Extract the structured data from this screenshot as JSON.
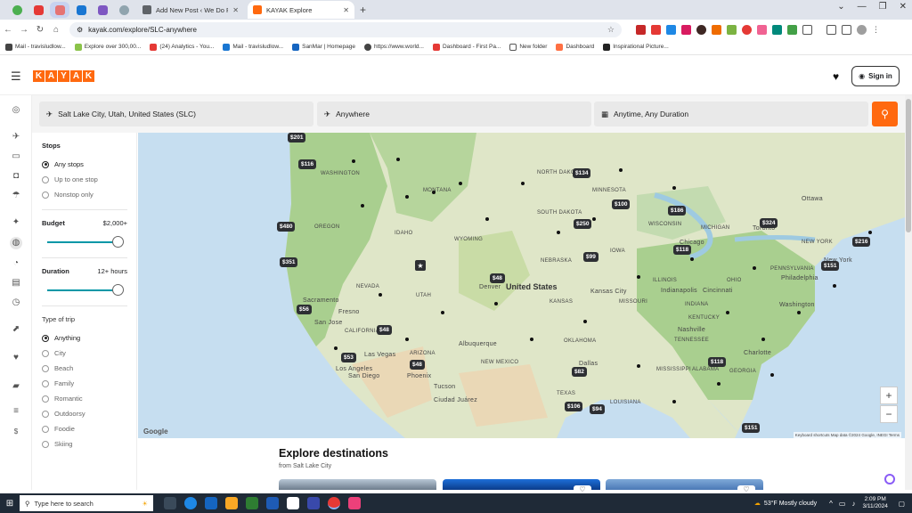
{
  "browser": {
    "tabs": [
      {
        "title": "Add New Post ‹ We Do Points —",
        "active": false,
        "favicon_color": "#5f6368"
      },
      {
        "title": "KAYAK Explore",
        "active": true,
        "favicon_color": "#ff690f"
      }
    ],
    "newtab_label": "+",
    "url": "kayak.com/explore/SLC-anywhere",
    "bookmarks": [
      {
        "label": "Mail - travisludlow...",
        "color": "#444"
      },
      {
        "label": "Explore over 300,00...",
        "color": "#8bc34a"
      },
      {
        "label": "(24) Analytics - You...",
        "color": "#e53935"
      },
      {
        "label": "Mail - travisludlow...",
        "color": "#1976d2"
      },
      {
        "label": "SanMar | Homepage",
        "color": "#1565c0"
      },
      {
        "label": "https://www.world...",
        "color": "#444"
      },
      {
        "label": "Dashboard - First Pa...",
        "color": "#e53935"
      },
      {
        "label": "New folder",
        "color": "#555"
      },
      {
        "label": "Dashboard",
        "color": "#ff7043"
      },
      {
        "label": "Inspirational Picture...",
        "color": "#222"
      }
    ]
  },
  "header": {
    "logo_letters": [
      "K",
      "A",
      "Y",
      "A",
      "K"
    ],
    "signin_label": "Sign in"
  },
  "search": {
    "origin": "Salt Lake City, Utah, United States (SLC)",
    "destination": "Anywhere",
    "dates": "Anytime, Any Duration"
  },
  "filters": {
    "stops": {
      "title": "Stops",
      "options": [
        "Any stops",
        "Up to one stop",
        "Nonstop only"
      ],
      "selected": 0
    },
    "budget": {
      "title": "Budget",
      "value": "$2,000+",
      "level": 1.0
    },
    "duration": {
      "title": "Duration",
      "value": "12+ hours",
      "level": 1.0
    },
    "trip_type": {
      "title": "Type of trip",
      "options": [
        "Anything",
        "City",
        "Beach",
        "Family",
        "Romantic",
        "Outdoorsy",
        "Foodie",
        "Skiing"
      ],
      "selected": 0
    }
  },
  "map": {
    "country_label": "United States",
    "state_labels": [
      "WASHINGTON",
      "OREGON",
      "IDAHO",
      "NEVADA",
      "UTAH",
      "WYOMING",
      "CALIFORNIA",
      "ARIZONA",
      "NEW MEXICO",
      "MONTANA",
      "NORTH DAKOTA",
      "SOUTH DAKOTA",
      "NEBRASKA",
      "KANSAS",
      "OKLAHOMA",
      "TEXAS",
      "MINNESOTA",
      "IOWA",
      "MISSOURI",
      "ILLINOIS",
      "WISCONSIN",
      "MICHIGAN",
      "INDIANA",
      "OHIO",
      "KENTUCKY",
      "TENNESSEE",
      "MISSISSIPPI",
      "ALABAMA",
      "GEORGIA",
      "LOUISIANA",
      "PENNSYLVANIA",
      "NEW YORK"
    ],
    "city_labels": [
      "Denver",
      "Las Vegas",
      "Los Angeles",
      "San Diego",
      "Phoenix",
      "Tucson",
      "Albuquerque",
      "Ciudad Juárez",
      "Dallas",
      "Kansas City",
      "Indianapolis",
      "Cincinnati",
      "Nashville",
      "Charlotte",
      "Washington",
      "Philadelphia",
      "New York",
      "Chicago",
      "Toronto",
      "Ottawa",
      "Sacramento",
      "San Jose",
      "Fresno"
    ],
    "prices": [
      "$201",
      "$116",
      "$134",
      "$100",
      "$186",
      "$324",
      "$480",
      "$250",
      "$351",
      "$99",
      "$118",
      "$216",
      "$151",
      "$48",
      "$56",
      "$48",
      "$53",
      "$48",
      "$82",
      "$118",
      "$106",
      "$94",
      "$151"
    ],
    "google_label": "Google",
    "attribution": "Keyboard shortcuts   Map data ©2024 Google, INEGI   Terms",
    "zoom_in": "+",
    "zoom_out": "−"
  },
  "explore": {
    "title": "Explore destinations",
    "subtitle": "from Salt Lake City"
  },
  "taskbar": {
    "search_placeholder": "Type here to search",
    "weather": "53°F  Mostly cloudy",
    "time": "2:09 PM",
    "date": "3/11/2024"
  }
}
